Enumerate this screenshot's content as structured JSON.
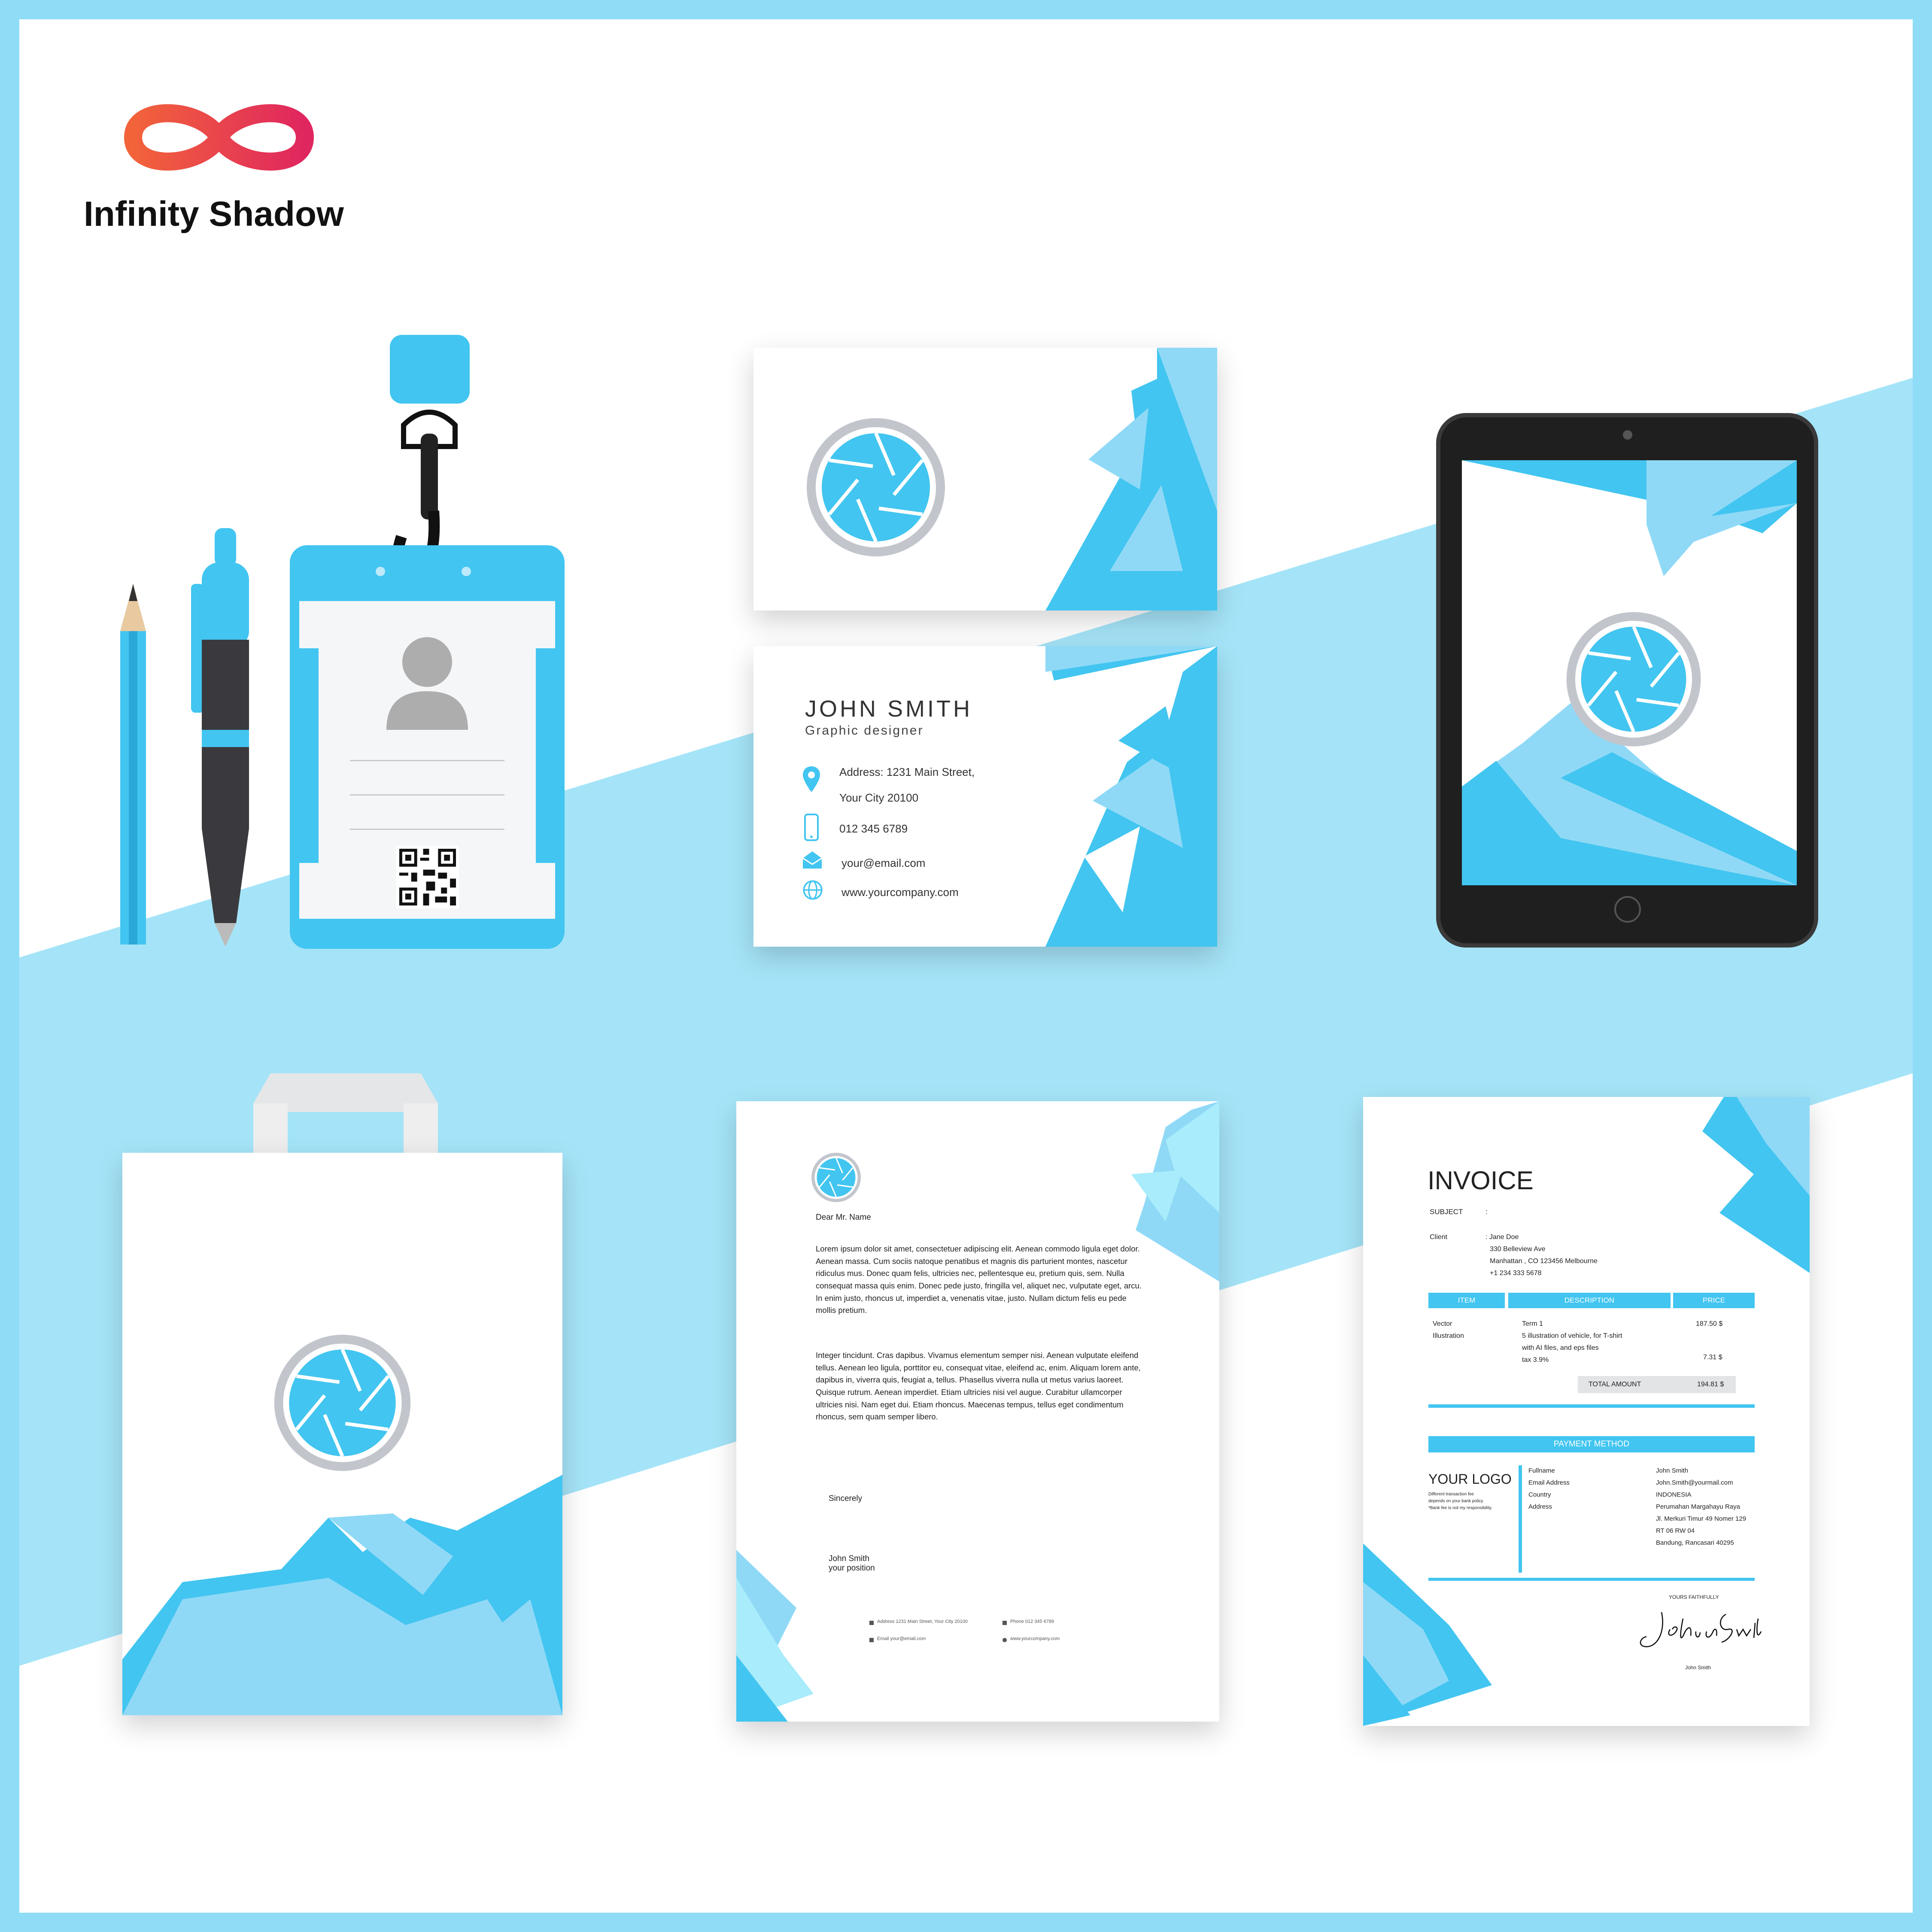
{
  "brand": {
    "name": "Infinity Shadow",
    "logo_icon": "infinity-logo-icon",
    "colors": {
      "frame": "#8fdcf7",
      "accent": "#42c5f0",
      "accent_light": "#8fd9f7",
      "band": "#a5e4f8",
      "logo_orange": "#f2633a",
      "logo_pink": "#e0265f"
    }
  },
  "business_card_front": {
    "name": "JOHN SMITH",
    "title": "Graphic designer",
    "address_line1": "Address: 1231 Main Street,",
    "address_line2": "Your City 20100",
    "phone": "012 345 6789",
    "email": "your@email.com",
    "website": "www.yourcompany.com"
  },
  "letterhead": {
    "greeting": "Dear Mr. Name",
    "paragraph1": "Lorem ipsum dolor sit amet, consectetuer adipiscing elit. Aenean commodo ligula eget dolor. Aenean massa. Cum sociis natoque penatibus et magnis dis parturient montes, nascetur ridiculus mus. Donec quam felis, ultricies nec, pellentesque eu, pretium quis, sem. Nulla consequat massa quis enim. Donec pede justo, fringilla vel, aliquet nec, vulputate eget, arcu. In enim justo, rhoncus ut, imperdiet a, venenatis vitae, justo. Nullam dictum felis eu pede mollis pretium.",
    "paragraph2": "Integer tincidunt. Cras dapibus. Vivamus elementum semper nisi. Aenean vulputate eleifend tellus. Aenean leo ligula, porttitor eu, consequat vitae, eleifend ac, enim. Aliquam lorem ante, dapibus in, viverra quis, feugiat a, tellus. Phasellus viverra nulla ut metus varius laoreet. Quisque rutrum. Aenean imperdiet. Etiam ultricies nisi vel augue. Curabitur ullamcorper ultricies nisi. Nam eget dui. Etiam rhoncus. Maecenas tempus, tellus eget condimentum rhoncus, sem quam semper libero.",
    "closing": "Sincerely",
    "signer_name": "John Smith",
    "signer_position": "your position",
    "footer_address": "Address 1231 Main Street, Your City 20100",
    "footer_phone": "Phone 012 345 6789",
    "footer_email": "Email your@email.com",
    "footer_web": "www.yourcompany.com"
  },
  "invoice": {
    "title": "INVOICE",
    "subject_label": "SUBJECT",
    "subject_colon": ":",
    "client_label": "Client",
    "client_name": ": Jane Doe",
    "client_addr1": "330 Belleview Ave",
    "client_addr2": "Manhattan , CO 123456 Melbourne",
    "client_phone": "+1 234 333 5678",
    "col_item": "ITEM",
    "col_description": "DESCRIPTION",
    "col_price": "PRICE",
    "item_line1": "Vector",
    "item_line2": "Illustration",
    "desc_line1": "Term 1",
    "desc_line2": "5 illustration of vehicle, for T-shirt",
    "desc_line3": "with AI files, and eps files",
    "desc_line4": "tax 3.9%",
    "price1": "187.50 $",
    "price2": "7.31 $",
    "total_label": "TOTAL AMOUNT",
    "total_value": "194.81 $",
    "payment_method": "PAYMENT METHOD",
    "your_logo": "YOUR LOGO",
    "logo_note1": "Different transaction fee",
    "logo_note2": "depends on your bank policy.",
    "logo_note3": "*Bank fee is not my responsibility.",
    "pay_label_fullname": "Fullname",
    "pay_label_email": "Email Address",
    "pay_label_country": "Country",
    "pay_label_address": "Address",
    "pay_fullname": "John Smith",
    "pay_email": "John.Smith@yourmail.com",
    "pay_country": "INDONESIA",
    "pay_addr1": "Perumahan Margahayu Raya",
    "pay_addr2": "Jl. Merkuri Timur 49 Nomer 129",
    "pay_addr3": "RT 06 RW 04",
    "pay_addr4": "Bandung, Rancasari 40295",
    "yours": "YOURS FAITHFULLY",
    "signature": "John Smith",
    "signer": "John Smith"
  }
}
